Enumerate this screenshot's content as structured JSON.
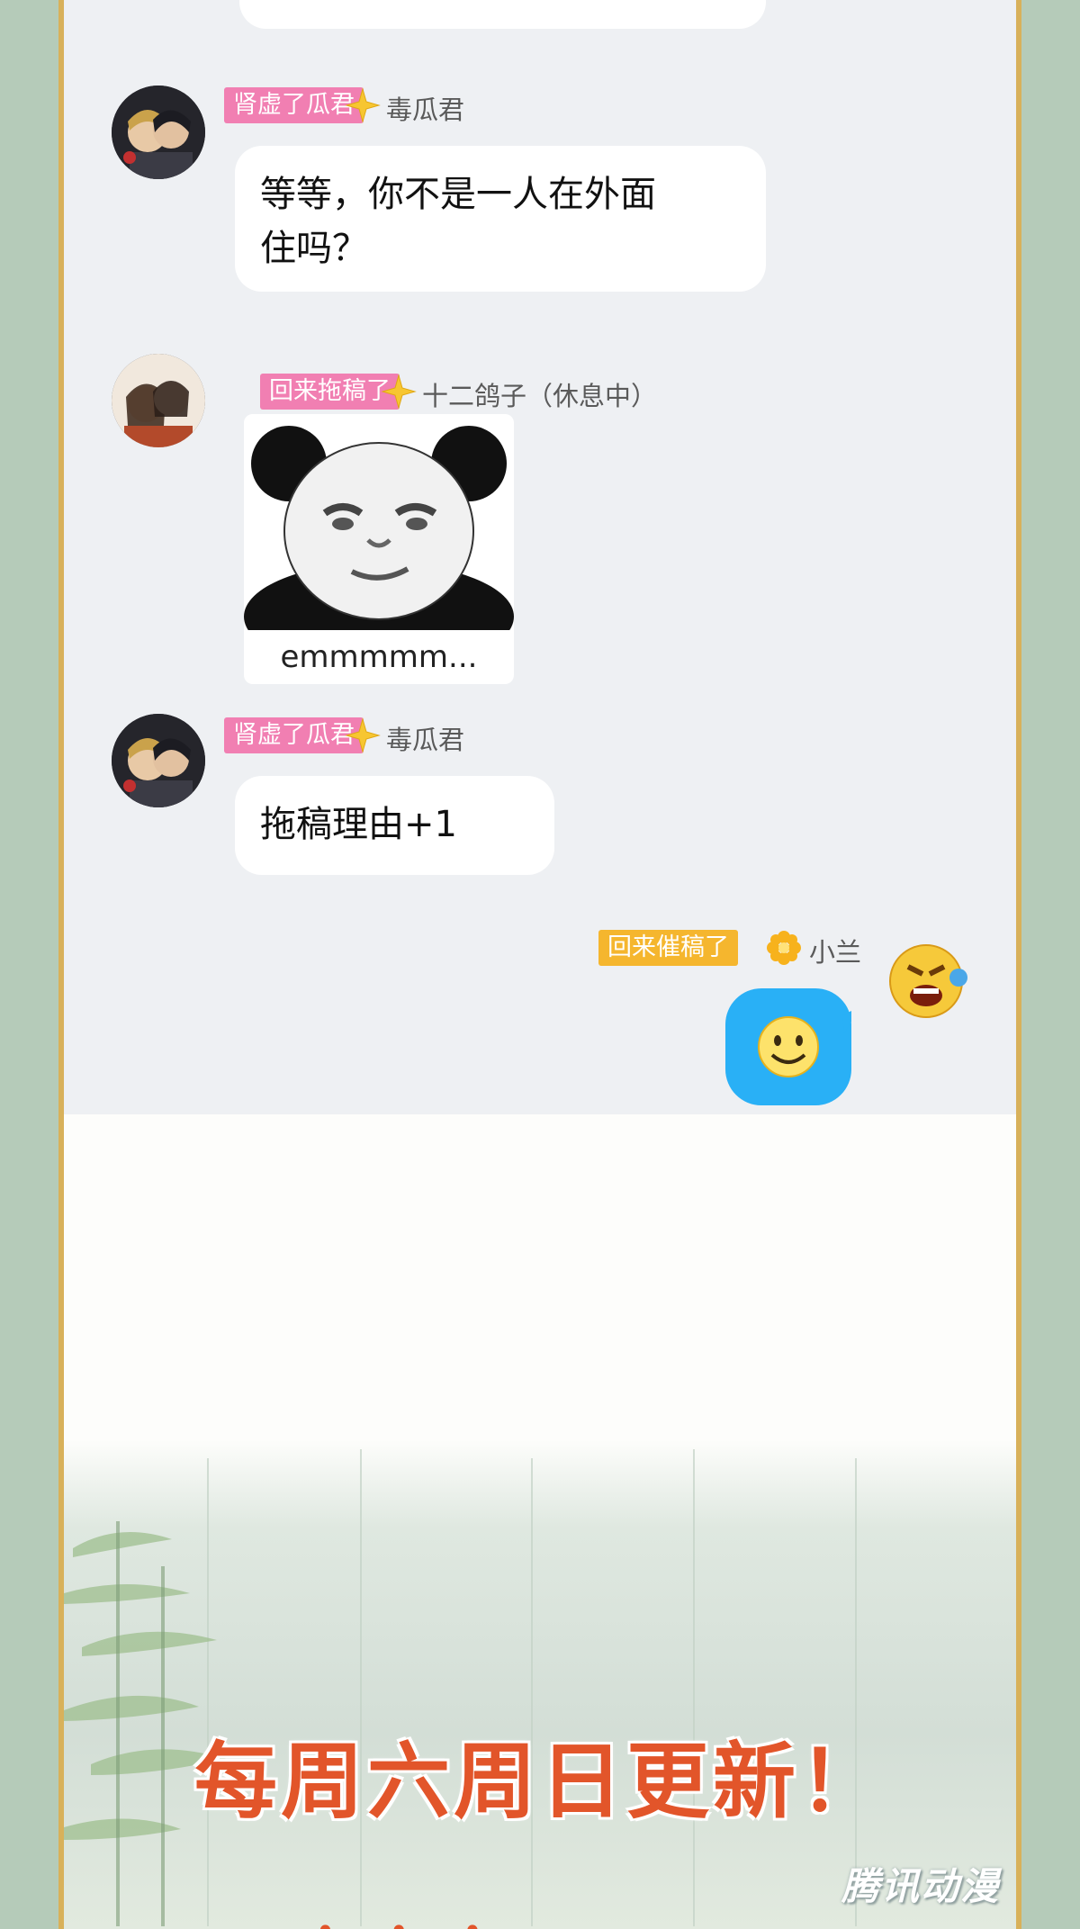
{
  "messages": [
    {
      "tag": "肾虚了瓜君",
      "username": "毒瓜君",
      "text_line1": "等等，你不是一人在外面",
      "text_line2": "住吗？"
    },
    {
      "tag": "回来拖稿了",
      "username": "十二鸽子（休息中）",
      "sticker_caption": "emmmmm..."
    },
    {
      "tag": "肾虚了瓜君",
      "username": "毒瓜君",
      "text": "拖稿理由+1"
    },
    {
      "tag": "回来催稿了",
      "username": "小兰",
      "emoji": "smile-emoji"
    }
  ],
  "banner": "每周六周日更新！",
  "watermark": "腾讯动漫",
  "colors": {
    "pink_tag": "#f17fb2",
    "gold_tag": "#f5b62e",
    "blue_bubble": "#29b0f6",
    "banner": "#e2552a",
    "frame": "#d8b15a",
    "side": "#b5cbb9"
  }
}
